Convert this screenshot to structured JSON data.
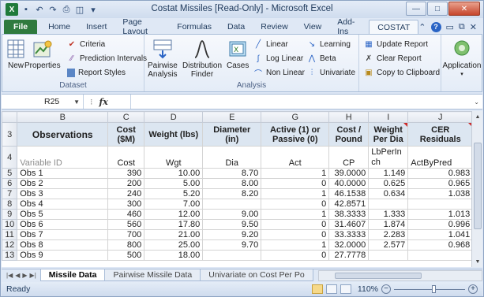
{
  "window": {
    "title": "Costat Missiles  [Read-Only]  -  Microsoft Excel",
    "minimize": "—",
    "restore": "□",
    "close": "✕"
  },
  "tabs": [
    "File",
    "Home",
    "Insert",
    "Page Layout",
    "Formulas",
    "Data",
    "Review",
    "View",
    "Add-Ins",
    "COSTAT"
  ],
  "ribbon": {
    "groups": {
      "dataset": "Dataset",
      "analysis": "Analysis"
    },
    "buttons": {
      "new": "New",
      "properties": "Properties",
      "criteria": "Criteria",
      "prediction_intervals": "Prediction Intervals",
      "report_styles": "Report Styles",
      "pairwise_line1": "Pairwise",
      "pairwise_line2": "Analysis",
      "distribution_line1": "Distribution",
      "distribution_line2": "Finder",
      "cases": "Cases",
      "linear": "Linear",
      "log_linear": "Log Linear",
      "non_linear": "Non Linear",
      "learning": "Learning",
      "beta": "Beta",
      "univariate": "Univariate",
      "update_report": "Update Report",
      "clear_report": "Clear Report",
      "copy_to_clipboard": "Copy to Clipboard",
      "application": "Application"
    }
  },
  "formula_bar": {
    "name_box": "R25",
    "fx": "fx",
    "value": ""
  },
  "columns": [
    "B",
    "C",
    "D",
    "E",
    "G",
    "H",
    "I",
    "J"
  ],
  "header_row": {
    "row_num": "3",
    "cells": [
      "Observations",
      "Cost ($M)",
      "Weight (lbs)",
      "Diameter (in)",
      "Active (1) or Passive (0)",
      "Cost / Pound",
      "Weight Per Dia",
      "CER Residuals"
    ]
  },
  "id_row": {
    "row_num": "4",
    "cells": [
      "Variable ID",
      "Cost",
      "Wgt",
      "Dia",
      "Act",
      "CP",
      "LbPerInch",
      "ActByPred"
    ]
  },
  "rows": [
    {
      "n": "5",
      "obs": "Obs 1",
      "cost": "390",
      "wgt": "10.00",
      "dia": "8.70",
      "act": "1",
      "cp": "39.0000",
      "lpi": "1.149",
      "abp": "0.983"
    },
    {
      "n": "6",
      "obs": "Obs 2",
      "cost": "200",
      "wgt": "5.00",
      "dia": "8.00",
      "act": "0",
      "cp": "40.0000",
      "lpi": "0.625",
      "abp": "0.965"
    },
    {
      "n": "7",
      "obs": "Obs 3",
      "cost": "240",
      "wgt": "5.20",
      "dia": "8.20",
      "act": "1",
      "cp": "46.1538",
      "lpi": "0.634",
      "abp": "1.038"
    },
    {
      "n": "8",
      "obs": "Obs 4",
      "cost": "300",
      "wgt": "7.00",
      "dia": "",
      "act": "0",
      "cp": "42.8571",
      "lpi": "",
      "abp": ""
    },
    {
      "n": "9",
      "obs": "Obs 5",
      "cost": "460",
      "wgt": "12.00",
      "dia": "9.00",
      "act": "1",
      "cp": "38.3333",
      "lpi": "1.333",
      "abp": "1.013"
    },
    {
      "n": "10",
      "obs": "Obs 6",
      "cost": "560",
      "wgt": "17.80",
      "dia": "9.50",
      "act": "0",
      "cp": "31.4607",
      "lpi": "1.874",
      "abp": "0.996"
    },
    {
      "n": "11",
      "obs": "Obs 7",
      "cost": "700",
      "wgt": "21.00",
      "dia": "9.20",
      "act": "0",
      "cp": "33.3333",
      "lpi": "2.283",
      "abp": "1.041"
    },
    {
      "n": "12",
      "obs": "Obs 8",
      "cost": "800",
      "wgt": "25.00",
      "dia": "9.70",
      "act": "1",
      "cp": "32.0000",
      "lpi": "2.577",
      "abp": "0.968"
    },
    {
      "n": "13",
      "obs": "Obs 9",
      "cost": "500",
      "wgt": "18.00",
      "dia": "",
      "act": "0",
      "cp": "27.7778",
      "lpi": "",
      "abp": ""
    }
  ],
  "sheets": [
    "Missile Data",
    "Pairwise Missile Data",
    "Univariate on Cost Per Po"
  ],
  "status": {
    "ready": "Ready",
    "zoom": "110%"
  },
  "colors": {
    "file_tab": "#2f7a3e",
    "header_fill": "#dce6f1",
    "comment_marker": "#cc2a2a"
  }
}
